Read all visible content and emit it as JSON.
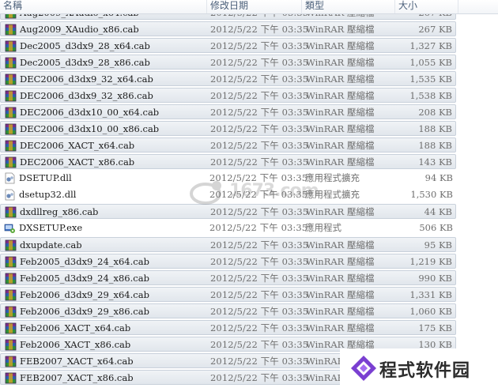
{
  "columns": {
    "name": "名稱",
    "date": "修改日期",
    "type": "類型",
    "size": "大小"
  },
  "files": [
    {
      "name": "Aug2009_XAudio_x64.cab",
      "date": "2012/5/22 下午 03:35",
      "type": "WinRAR 壓縮檔",
      "size": "267 KB",
      "icon": "winrar-archive-icon",
      "sel": true
    },
    {
      "name": "Aug2009_XAudio_x86.cab",
      "date": "2012/5/22 下午 03:35",
      "type": "WinRAR 壓縮檔",
      "size": "267 KB",
      "icon": "winrar-archive-icon",
      "sel": true
    },
    {
      "name": "Dec2005_d3dx9_28_x64.cab",
      "date": "2012/5/22 下午 03:35",
      "type": "WinRAR 壓縮檔",
      "size": "1,327 KB",
      "icon": "winrar-archive-icon",
      "sel": true
    },
    {
      "name": "Dec2005_d3dx9_28_x86.cab",
      "date": "2012/5/22 下午 03:35",
      "type": "WinRAR 壓縮檔",
      "size": "1,055 KB",
      "icon": "winrar-archive-icon",
      "sel": true
    },
    {
      "name": "DEC2006_d3dx9_32_x64.cab",
      "date": "2012/5/22 下午 03:35",
      "type": "WinRAR 壓縮檔",
      "size": "1,535 KB",
      "icon": "winrar-archive-icon",
      "sel": true
    },
    {
      "name": "DEC2006_d3dx9_32_x86.cab",
      "date": "2012/5/22 下午 03:35",
      "type": "WinRAR 壓縮檔",
      "size": "1,538 KB",
      "icon": "winrar-archive-icon",
      "sel": true
    },
    {
      "name": "DEC2006_d3dx10_00_x64.cab",
      "date": "2012/5/22 下午 03:35",
      "type": "WinRAR 壓縮檔",
      "size": "208 KB",
      "icon": "winrar-archive-icon",
      "sel": true
    },
    {
      "name": "DEC2006_d3dx10_00_x86.cab",
      "date": "2012/5/22 下午 03:35",
      "type": "WinRAR 壓縮檔",
      "size": "188 KB",
      "icon": "winrar-archive-icon",
      "sel": true
    },
    {
      "name": "DEC2006_XACT_x64.cab",
      "date": "2012/5/22 下午 03:35",
      "type": "WinRAR 壓縮檔",
      "size": "188 KB",
      "icon": "winrar-archive-icon",
      "sel": true
    },
    {
      "name": "DEC2006_XACT_x86.cab",
      "date": "2012/5/22 下午 03:35",
      "type": "WinRAR 壓縮檔",
      "size": "143 KB",
      "icon": "winrar-archive-icon",
      "sel": true
    },
    {
      "name": "DSETUP.dll",
      "date": "2012/5/22 下午 03:35",
      "type": "應用程式擴充",
      "size": "94 KB",
      "icon": "dll-file-icon",
      "sel": false
    },
    {
      "name": "dsetup32.dll",
      "date": "2012/5/22 下午 03:35",
      "type": "應用程式擴充",
      "size": "1,530 KB",
      "icon": "dll-file-icon",
      "sel": false
    },
    {
      "name": "dxdllreg_x86.cab",
      "date": "2012/5/22 下午 03:35",
      "type": "WinRAR 壓縮檔",
      "size": "44 KB",
      "icon": "winrar-archive-icon",
      "sel": true
    },
    {
      "name": "DXSETUP.exe",
      "date": "2012/5/22 下午 03:35",
      "type": "應用程式",
      "size": "506 KB",
      "icon": "setup-exe-icon",
      "sel": false
    },
    {
      "name": "dxupdate.cab",
      "date": "2012/5/22 下午 03:35",
      "type": "WinRAR 壓縮檔",
      "size": "95 KB",
      "icon": "winrar-archive-icon",
      "sel": true
    },
    {
      "name": "Feb2005_d3dx9_24_x64.cab",
      "date": "2012/5/22 下午 03:35",
      "type": "WinRAR 壓縮檔",
      "size": "1,219 KB",
      "icon": "winrar-archive-icon",
      "sel": true
    },
    {
      "name": "Feb2005_d3dx9_24_x86.cab",
      "date": "2012/5/22 下午 03:35",
      "type": "WinRAR 壓縮檔",
      "size": "990 KB",
      "icon": "winrar-archive-icon",
      "sel": true
    },
    {
      "name": "Feb2006_d3dx9_29_x64.cab",
      "date": "2012/5/22 下午 03:35",
      "type": "WinRAR 壓縮檔",
      "size": "1,331 KB",
      "icon": "winrar-archive-icon",
      "sel": true
    },
    {
      "name": "Feb2006_d3dx9_29_x86.cab",
      "date": "2012/5/22 下午 03:35",
      "type": "WinRAR 壓縮檔",
      "size": "1,060 KB",
      "icon": "winrar-archive-icon",
      "sel": true
    },
    {
      "name": "Feb2006_XACT_x64.cab",
      "date": "2012/5/22 下午 03:35",
      "type": "WinRAR 壓縮檔",
      "size": "175 KB",
      "icon": "winrar-archive-icon",
      "sel": true
    },
    {
      "name": "Feb2006_XACT_x86.cab",
      "date": "2012/5/22 下午 03:35",
      "type": "WinRAR 壓縮檔",
      "size": "130 KB",
      "icon": "winrar-archive-icon",
      "sel": true
    },
    {
      "name": "FEB2007_XACT_x64.cab",
      "date": "2012/5/22 下午 03:35",
      "type": "WinRAR 壓縮檔",
      "size": "",
      "icon": "winrar-archive-icon",
      "sel": true
    },
    {
      "name": "FEB2007_XACT_x86.cab",
      "date": "2012/5/22 下午 03:35",
      "type": "WinRAR 壓縮檔",
      "size": "",
      "icon": "winrar-archive-icon",
      "sel": true
    }
  ],
  "watermark": {
    "text": "1673.com"
  },
  "brand": {
    "text": "程式软件园"
  }
}
